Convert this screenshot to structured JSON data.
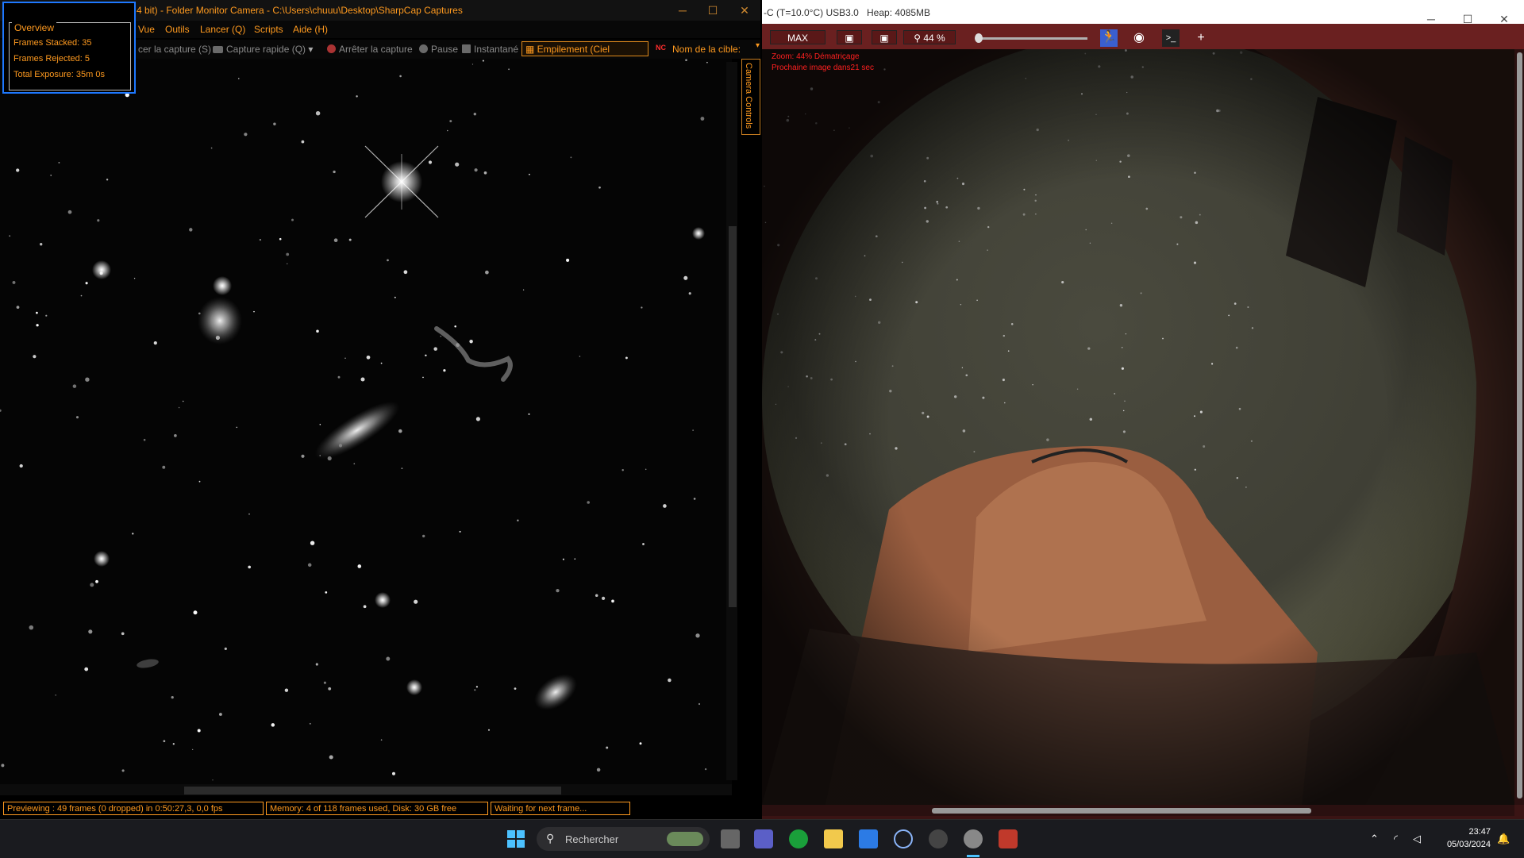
{
  "sharpcap": {
    "title": "4 bit) - Folder Monitor Camera - C:\\Users\\chuuu\\Desktop\\SharpCap Captures",
    "window_controls": {
      "minimize": "─",
      "maximize": "☐",
      "close": "✕"
    },
    "menu": [
      "Vue",
      "Outils",
      "Lancer (Q)",
      "Scripts",
      "Aide (H)"
    ],
    "toolbar": {
      "start_capture": "cer la capture (S)",
      "quick_capture": "Capture rapide (Q)",
      "stop_capture": "Arrêter la capture",
      "pause": "Pause",
      "snapshot": "Instantané",
      "live_stack": "Empilement (Ciel profond)",
      "nc_badge": "NC",
      "target_name": "Nom de la cible:"
    },
    "camera_controls_tab": "Camera Controls",
    "overview": {
      "header": "Overview",
      "frames_stacked": "Frames Stacked:   35",
      "frames_rejected": "Frames Rejected:  5",
      "total_exposure": "Total Exposure:    35m 0s"
    },
    "status": {
      "previewing": "Previewing : 49 frames (0 dropped) in 0:50:27,3, 0,0 fps",
      "memory": "Memory: 4 of 118 frames used, Disk: 30 GB free",
      "waiting": "Waiting for next frame..."
    }
  },
  "allsky": {
    "title_camera": "-C (T=10.0°C) USB3.0",
    "title_heap": "Heap: 4085MB",
    "window_controls": {
      "minimize": "─",
      "maximize": "☐",
      "close": "✕"
    },
    "toolbar": {
      "max": "MAX",
      "zoom": "44 %",
      "add": "+"
    },
    "overlay": {
      "line1": "Zoom: 44%    Dématriçage",
      "line2": "Prochaine image dans21 sec"
    }
  },
  "taskbar": {
    "search_placeholder": "Rechercher",
    "time": "23:47",
    "date": "05/03/2024",
    "apps": [
      "start-icon",
      "task-view-icon",
      "teams-icon",
      "xbox-icon",
      "file-explorer-icon",
      "store-icon",
      "app-globe-icon",
      "app-circle-icon",
      "sharpcap-icon",
      "app-red-icon"
    ]
  },
  "colors": {
    "sharpcap_accent": "#ff9a1f",
    "overview_border": "#1e78ff",
    "allsky_toolbar": "#6a2020",
    "overlay_red": "#ff2020"
  }
}
